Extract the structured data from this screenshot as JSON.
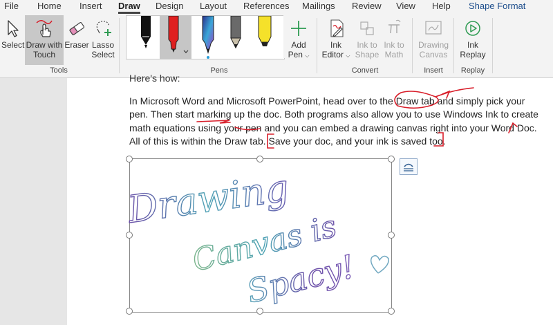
{
  "menu": {
    "tabs": [
      "File",
      "Home",
      "Insert",
      "Draw",
      "Design",
      "Layout",
      "References",
      "Mailings",
      "Review",
      "View",
      "Help",
      "Shape Format"
    ],
    "active_tab": "Draw"
  },
  "ribbon": {
    "tools": {
      "select": "Select",
      "draw_with_touch_1": "Draw with",
      "draw_with_touch_2": "Touch",
      "eraser": "Eraser",
      "lasso_1": "Lasso",
      "lasso_2": "Select",
      "group_label": "Tools"
    },
    "pens": {
      "add_pen_1": "Add",
      "add_pen_2": "Pen",
      "group_label": "Pens",
      "colors": [
        "#111111",
        "#e02020",
        "#3a7bd5",
        "#6a6a6a",
        "#f5e12a"
      ]
    },
    "convert": {
      "ink_editor_1": "Ink",
      "ink_editor_2": "Editor",
      "ink_to_shape_1": "Ink to",
      "ink_to_shape_2": "Shape",
      "ink_to_math_1": "Ink to",
      "ink_to_math_2": "Math",
      "group_label": "Convert"
    },
    "insert": {
      "drawing_canvas_1": "Drawing",
      "drawing_canvas_2": "Canvas",
      "group_label": "Insert"
    },
    "replay": {
      "ink_replay_1": "Ink",
      "ink_replay_2": "Replay",
      "group_label": "Replay"
    }
  },
  "document": {
    "cut_line": "Here's how:",
    "lines": [
      "In Microsoft Word and Microsoft PowerPoint, head over to the Draw tab and simply pick your",
      "pen. Then start marking up the doc. Both programs also allow you to use Windows Ink to create",
      "math equations using your pen and you can embed a drawing canvas right into your Word Doc.",
      "All of this is within the Draw tab. Save your doc, and your ink is saved too."
    ],
    "ink_text": [
      "Drawing",
      "Canvas is",
      "Spacy!"
    ]
  },
  "colors": {
    "ink_red": "#d81e2a",
    "ink_teal": "#4fa3b5",
    "ink_purple": "#6b4fa8",
    "ink_green": "#7ab48a",
    "accent_tab": "#1e4e8c"
  }
}
